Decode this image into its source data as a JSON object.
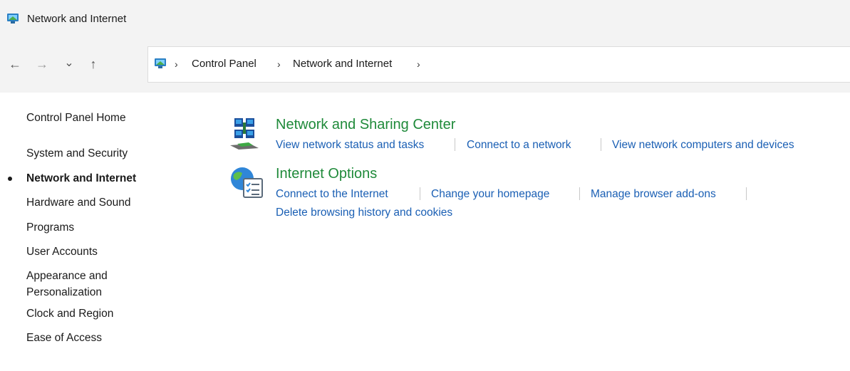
{
  "window": {
    "title": "Network and Internet"
  },
  "navigation": {
    "back_icon": "back-arrow-icon",
    "forward_icon": "forward-arrow-icon",
    "recent_icon": "chevron-down-icon",
    "up_icon": "up-arrow-icon",
    "back_glyph": "←",
    "forward_glyph": "→",
    "recent_glyph": "⌄",
    "up_glyph": "↑"
  },
  "breadcrumb": {
    "separator": "›",
    "items": [
      "Control Panel",
      "Network and Internet"
    ]
  },
  "sidebar": {
    "items": [
      {
        "label": "Control Panel Home",
        "current": false
      },
      {
        "label": "System and Security",
        "current": false
      },
      {
        "label": "Network and Internet",
        "current": true
      },
      {
        "label": "Hardware and Sound",
        "current": false
      },
      {
        "label": "Programs",
        "current": false
      },
      {
        "label": "User Accounts",
        "current": false
      },
      {
        "label": "Appearance and",
        "current": false
      },
      {
        "label": "Personalization",
        "current": false
      },
      {
        "label": "Clock and Region",
        "current": false
      },
      {
        "label": "Ease of Access",
        "current": false
      }
    ]
  },
  "categories": [
    {
      "title": "Network and Sharing Center",
      "icon": "network-sharing-center-icon",
      "tasks": [
        "View network status and tasks",
        "Connect to a network",
        "View network computers and devices"
      ]
    },
    {
      "title": "Internet Options",
      "icon": "internet-options-icon",
      "tasks": [
        "Connect to the Internet",
        "Change your homepage",
        "Manage browser add-ons",
        "Delete browsing history and cookies"
      ]
    }
  ],
  "colors": {
    "category_title": "#1f8a3a",
    "task_link": "#1a5fb4",
    "chrome_background": "#f3f3f3"
  }
}
